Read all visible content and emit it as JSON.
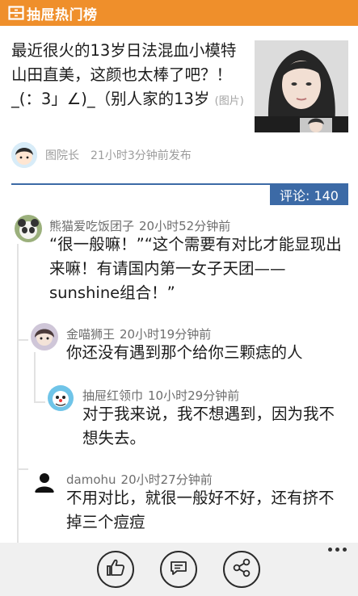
{
  "app": {
    "title": "抽屉热门榜"
  },
  "article": {
    "headline": "最近很火的13岁日法混血小模特 山田直美，这颜也太棒了吧？！_(：3」∠)_（别人家的13岁",
    "tag": "(图片)",
    "author": "图院长",
    "posted": "21小时3分钟前发布"
  },
  "comments_count_label": "评论: 140",
  "comments": [
    {
      "user": "熊猫爱吃饭团子",
      "time": "20小时52分钟前",
      "text": "“很一般嘛！”“这个需要有对比才能显现出来嘛！有请国内第一女子天团——sunshine组合！”"
    },
    {
      "user": "金喵狮王",
      "time": "20小时19分钟前",
      "text": "你还没有遇到那个给你三颗痣的人"
    },
    {
      "user": "抽屉红领巾",
      "time": "10小时29分钟前",
      "text": "对于我来说，我不想遇到，因为我不想失去。"
    },
    {
      "user": "damohu",
      "time": "20小时27分钟前",
      "text": "不用对比，就很一般好不好，还有挤不掉三个痘痘"
    }
  ],
  "appbar": {
    "icons": [
      "thumbs-up-icon",
      "comment-icon",
      "share-icon"
    ],
    "more": "..."
  },
  "colors": {
    "accent_orange": "#ef8f2b",
    "accent_blue": "#3c6aa6"
  }
}
